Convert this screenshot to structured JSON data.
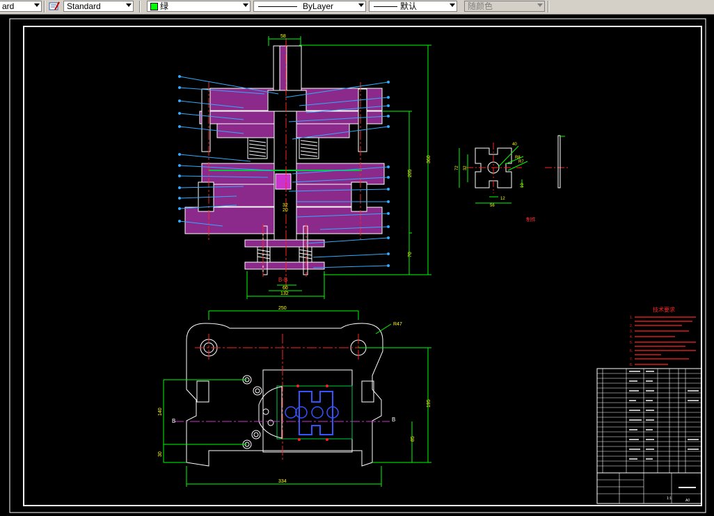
{
  "toolbar": {
    "style_partial": "ard",
    "text_style": "Standard",
    "layer": "绿",
    "layer_color": "#00ff00",
    "linetype": "ByLayer",
    "lineweight": "默认",
    "plot_style": "随颜色"
  },
  "drawing": {
    "section_label": "B-B",
    "dims_top": {
      "top_width": "58",
      "inner_a": "32",
      "inner_b": "20",
      "bottom_a": "60",
      "bottom_b": "132",
      "height_total": "360",
      "height_mid": "205",
      "height_low": "70"
    },
    "part_dims": {
      "d1": "40",
      "d2": "R8",
      "d3": "R7",
      "w": "72",
      "h": "32",
      "b1": "12",
      "b2": "56",
      "t": "10"
    },
    "part_label": "制件",
    "plan_dims": {
      "top": "250",
      "radius": "R47",
      "bottom": "334",
      "left_a": "140",
      "left_b": "30",
      "right_a": "195",
      "right_b": "85"
    },
    "section_marks": {
      "left": "B",
      "right": "B"
    },
    "tech_req_title": "技术要求",
    "tech_req_items": [
      "1.",
      "2.",
      "3.",
      "4.",
      "5.",
      "6.",
      "7.",
      "8."
    ],
    "title_block": {
      "scale": "1:1",
      "sheet": "A0"
    }
  }
}
